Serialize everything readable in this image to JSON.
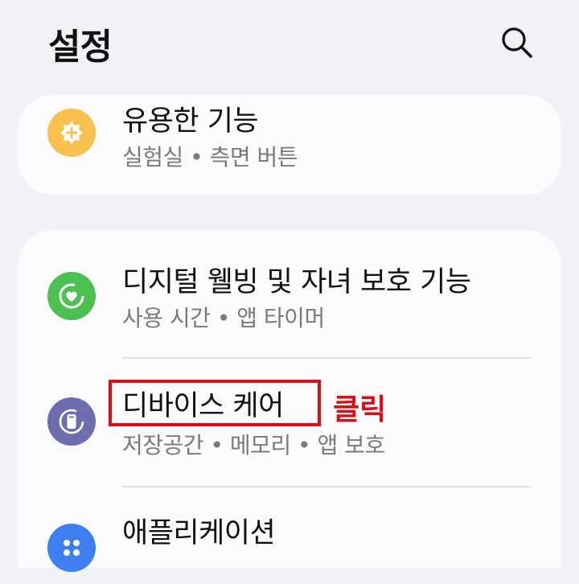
{
  "header": {
    "title": "설정"
  },
  "colors": {
    "useful_icon": "#f7c04f",
    "digital_icon": "#4cc04f",
    "device_icon": "#6e6db0",
    "apps_icon": "#3d7ef0",
    "annotation": "#d80f14"
  },
  "items": [
    {
      "title": "유용한 기능",
      "subtitle": "실험실 • 측면 버튼",
      "icon": "puzzle-plus-icon"
    },
    {
      "title": "디지털 웰빙 및 자녀 보호 기능",
      "subtitle": "사용 시간 • 앱 타이머",
      "icon": "heart-ring-icon"
    },
    {
      "title": "디바이스 케어",
      "subtitle": "저장공간 • 메모리 • 앱 보호",
      "icon": "device-care-icon"
    },
    {
      "title": "애플리케이션",
      "icon": "apps-icon"
    }
  ],
  "annotation": {
    "label": "클릭"
  }
}
